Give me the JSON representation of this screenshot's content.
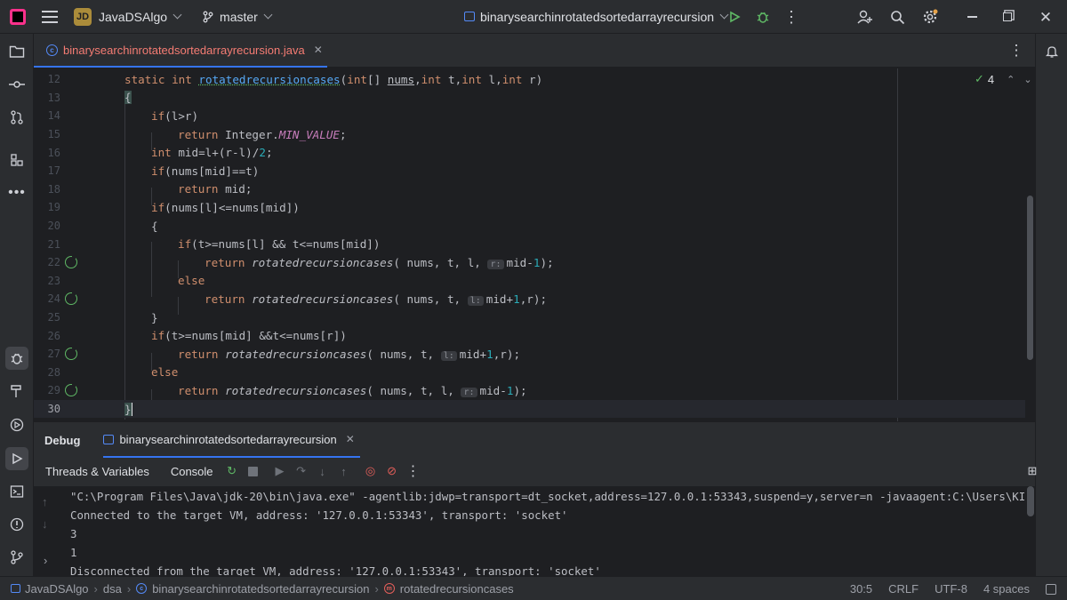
{
  "titlebar": {
    "project_badge": "JD",
    "project_name": "JavaDSAlgo",
    "branch": "master",
    "run_config": "binarysearchinrotatedsortedarrayrecursion"
  },
  "tab": {
    "label": "binarysearchinrotatedsortedarrayrecursion.java"
  },
  "inspections": {
    "count": "4"
  },
  "editor": {
    "lines": [
      {
        "n": "12",
        "text": "static int rotatedrecursioncases(int[] nums,int t,int l,int r)"
      },
      {
        "n": "13",
        "text": "{"
      },
      {
        "n": "14",
        "text": "if(l>r)"
      },
      {
        "n": "15",
        "text": "return Integer.MIN_VALUE;"
      },
      {
        "n": "16",
        "text": "int mid=l+(r-l)/2;"
      },
      {
        "n": "17",
        "text": "if(nums[mid]==t)"
      },
      {
        "n": "18",
        "text": "return mid;"
      },
      {
        "n": "19",
        "text": "if(nums[l]<=nums[mid])"
      },
      {
        "n": "20",
        "text": "{"
      },
      {
        "n": "21",
        "text": "if(t>=nums[l] && t<=nums[mid])"
      },
      {
        "n": "22",
        "text": "return rotatedrecursioncases( nums, t, l, r: mid-1);"
      },
      {
        "n": "23",
        "text": "else"
      },
      {
        "n": "24",
        "text": "return rotatedrecursioncases( nums, t, l: mid+1,r);"
      },
      {
        "n": "25",
        "text": "}"
      },
      {
        "n": "26",
        "text": "if(t>=nums[mid] &&t<=nums[r])"
      },
      {
        "n": "27",
        "text": "return rotatedrecursioncases( nums, t, l: mid+1,r);"
      },
      {
        "n": "28",
        "text": "else"
      },
      {
        "n": "29",
        "text": "return rotatedrecursioncases( nums, t, l, r: mid-1);"
      },
      {
        "n": "30",
        "text": "}"
      }
    ]
  },
  "debug": {
    "title": "Debug",
    "session_tab": "binarysearchinrotatedsortedarrayrecursion",
    "threads_tab": "Threads & Variables",
    "console_tab": "Console",
    "console_lines": [
      "\"C:\\Program Files\\Java\\jdk-20\\bin\\java.exe\" -agentlib:jdwp=transport=dt_socket,address=127.0.0.1:53343,suspend=y,server=n -javaagent:C:\\Users\\KI",
      "Connected to the target VM, address: '127.0.0.1:53343', transport: 'socket'",
      "3",
      "1",
      "Disconnected from the target VM, address: '127.0.0.1:53343', transport: 'socket'"
    ]
  },
  "statusbar": {
    "crumbs": [
      "JavaDSAlgo",
      "dsa",
      "binarysearchinrotatedsortedarrayrecursion",
      "rotatedrecursioncases"
    ],
    "position": "30:5",
    "line_sep": "CRLF",
    "encoding": "UTF-8",
    "indent": "4 spaces"
  }
}
